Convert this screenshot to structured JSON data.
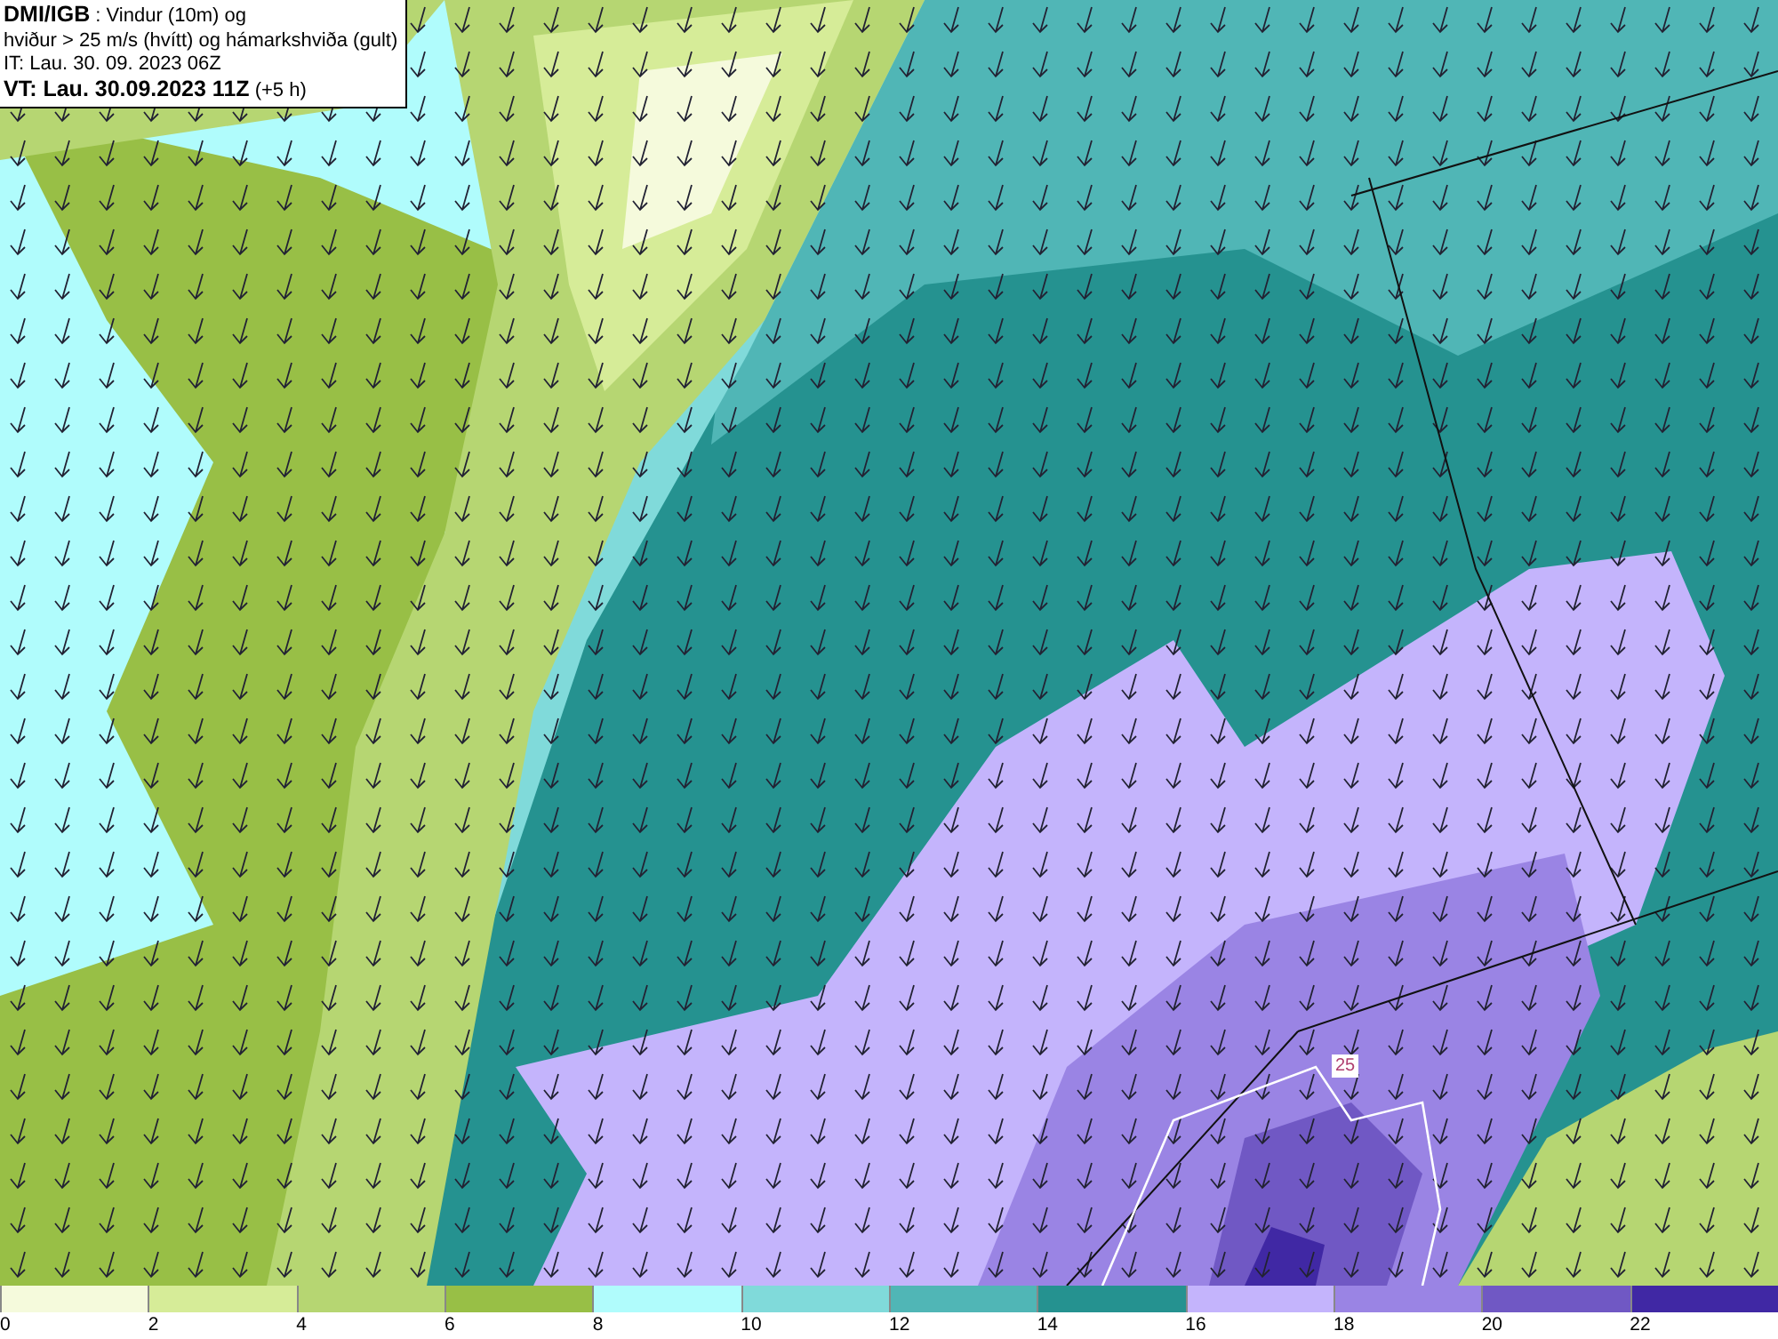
{
  "header": {
    "lines": [
      "**DMI/IGB** : Vindur (10m) og",
      "hviður > 25 m/s (hvítt) og hámarkshviða (gult)",
      "IT: Lau. 30. 09. 2023 06Z",
      "**VT: Lau. 30.09.2023 11Z** (+5 h)"
    ]
  },
  "map": {
    "contour_label": "25"
  },
  "legend": [
    {
      "label": "0",
      "color": "#f5fadc"
    },
    {
      "label": "2",
      "color": "#d6ec98"
    },
    {
      "label": "4",
      "color": "#b6d672"
    },
    {
      "label": "6",
      "color": "#98bf46"
    },
    {
      "label": "8",
      "color": "#b0fcfc"
    },
    {
      "label": "10",
      "color": "#80dada"
    },
    {
      "label": "12",
      "color": "#50b6b6"
    },
    {
      "label": "14",
      "color": "#259290"
    },
    {
      "label": "16",
      "color": "#c4b4fc"
    },
    {
      "label": "18",
      "color": "#9a84e4"
    },
    {
      "label": "20",
      "color": "#7058c4"
    },
    {
      "label": "22",
      "color": "#4028a4"
    }
  ]
}
